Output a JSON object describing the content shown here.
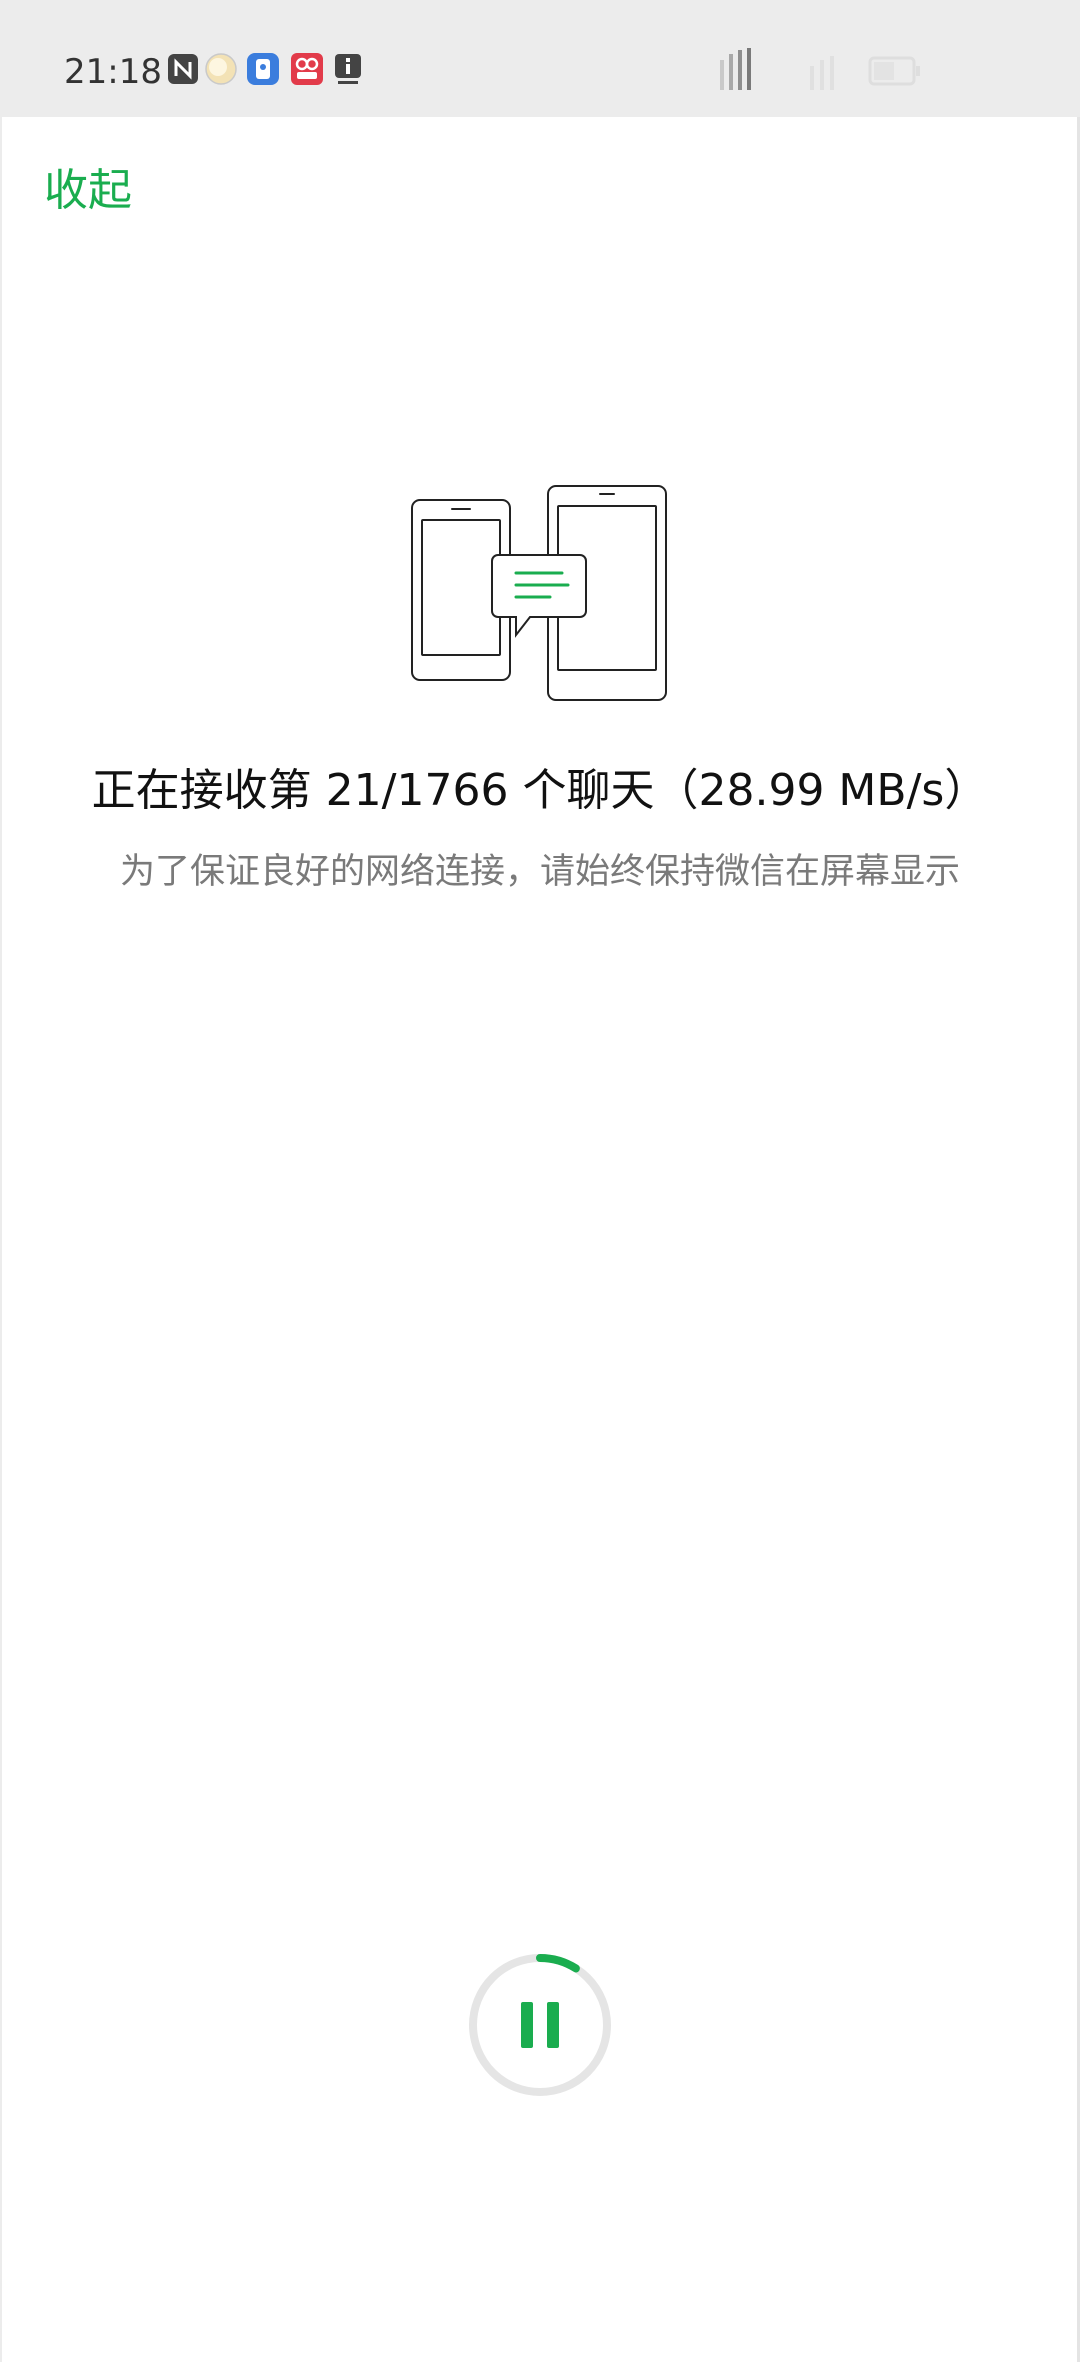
{
  "status_bar": {
    "time": "21:18",
    "icons": [
      "nfc-icon",
      "weather-icon",
      "app-blue-icon",
      "app-red-icon",
      "info-icon"
    ],
    "right_icons": [
      "signal-icon",
      "wifi-icon",
      "battery-icon"
    ]
  },
  "header": {
    "collapse_label": "收起"
  },
  "transfer": {
    "title_prefix": "正在接收第 ",
    "current": "21",
    "separator": "/",
    "total": "1766",
    "title_middle": " 个聊天（",
    "speed": "28.99 MB/s",
    "title_suffix": "）",
    "subtitle": "为了保证良好的网络连接，请始终保持微信在屏幕显示",
    "progress_fraction": 0.0119
  },
  "controls": {
    "pause_icon": "pause-icon"
  },
  "colors": {
    "accent": "#1aad4f",
    "status_bar_bg": "#ececec",
    "subtitle_text": "#7a7a7a",
    "ring_track": "#e5e5e5"
  }
}
